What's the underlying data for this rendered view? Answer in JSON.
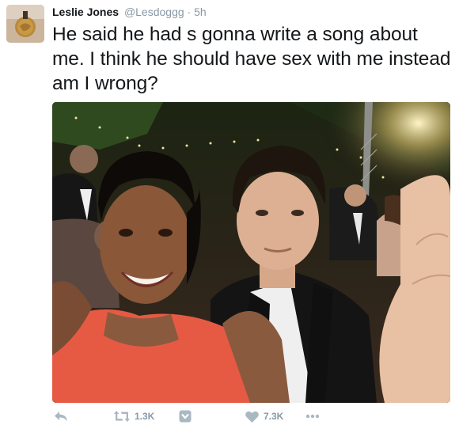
{
  "tweet": {
    "author": {
      "display_name": "Leslie Jones",
      "username": "@Lesdoggg",
      "avatar_icon": "avatar-photo"
    },
    "separator": "·",
    "timestamp": "5h",
    "text": "He said he had s gonna write a song about me. I think he should have sex with me instead am I wrong?",
    "media": {
      "type": "photo",
      "alt": ""
    },
    "actions": {
      "reply_icon": "reply-icon",
      "retweet_icon": "retweet-icon",
      "retweet_count": "1.3K",
      "moment_icon": "moment-icon",
      "like_icon": "heart-icon",
      "like_count": "7.3K",
      "more_icon": "more-icon"
    }
  },
  "colors": {
    "text": "#14171a",
    "secondary": "#8899a6",
    "action_icon": "#aab8c2",
    "background": "#ffffff"
  }
}
